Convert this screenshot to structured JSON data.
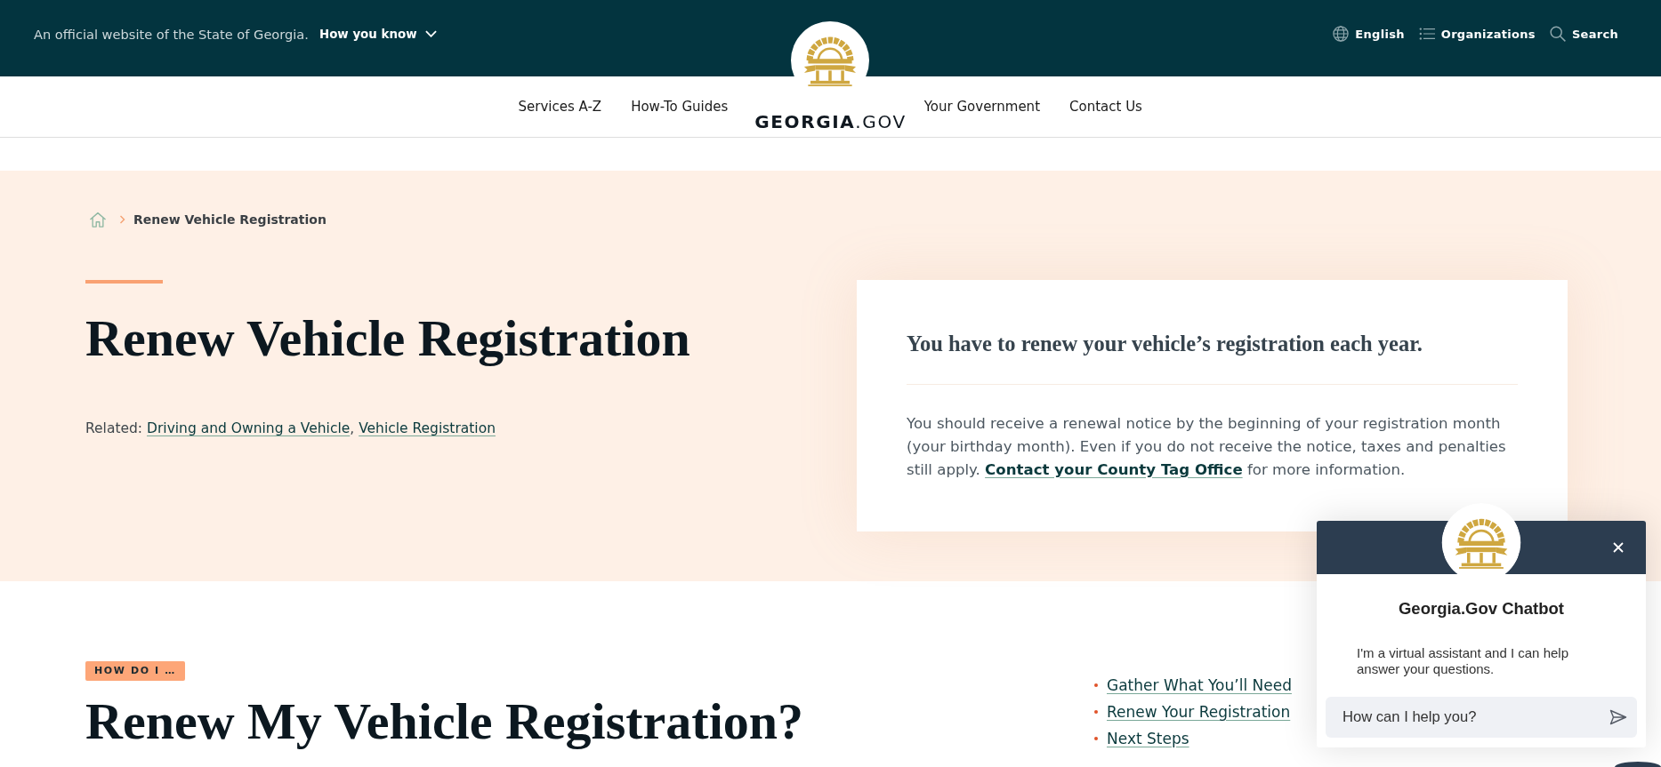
{
  "banner": {
    "notice": "An official website of the State of Georgia.",
    "toggle": {
      "label": "How you know",
      "expanded": false
    },
    "links": [
      {
        "kind": "language",
        "label": "English"
      },
      {
        "kind": "organizations",
        "label": "Organizations"
      },
      {
        "kind": "search",
        "label": "Search"
      }
    ]
  },
  "nav": {
    "left": [
      "Services A-Z",
      "How-To Guides"
    ],
    "logo": "**GEORGIA**.GOV",
    "right": [
      "Your Government",
      "Contact Us"
    ]
  },
  "breadcrumb": {
    "current": "Renew Vehicle Registration"
  },
  "hero": {
    "title": "Renew Vehicle Registration",
    "related": {
      "label": "Related:",
      "separator": ",",
      "links": [
        "Driving and Owning a Vehicle",
        "Vehicle Registration"
      ]
    },
    "card": {
      "heading": "You have to renew your vehicle’s registration each year.",
      "text_before": "You should receive a renewal notice by the beginning of your registration month (your birthday month). Even if you do not receive the notice, taxes and penalties still apply.",
      "link": "Contact your County Tag Office",
      "text_after": "for more information."
    }
  },
  "how_to": {
    "eyebrow": "HOW DO I …",
    "title": "Renew My Vehicle Registration?",
    "steps": [
      "Gather What You’ll Need",
      "Renew Your Registration",
      "Next Steps"
    ]
  },
  "chatbot": {
    "title": "Georgia.Gov Chatbot",
    "message": "I'm a virtual assistant and I can help answer your questions.",
    "input": {
      "placeholder": "How can I help you?"
    }
  }
}
